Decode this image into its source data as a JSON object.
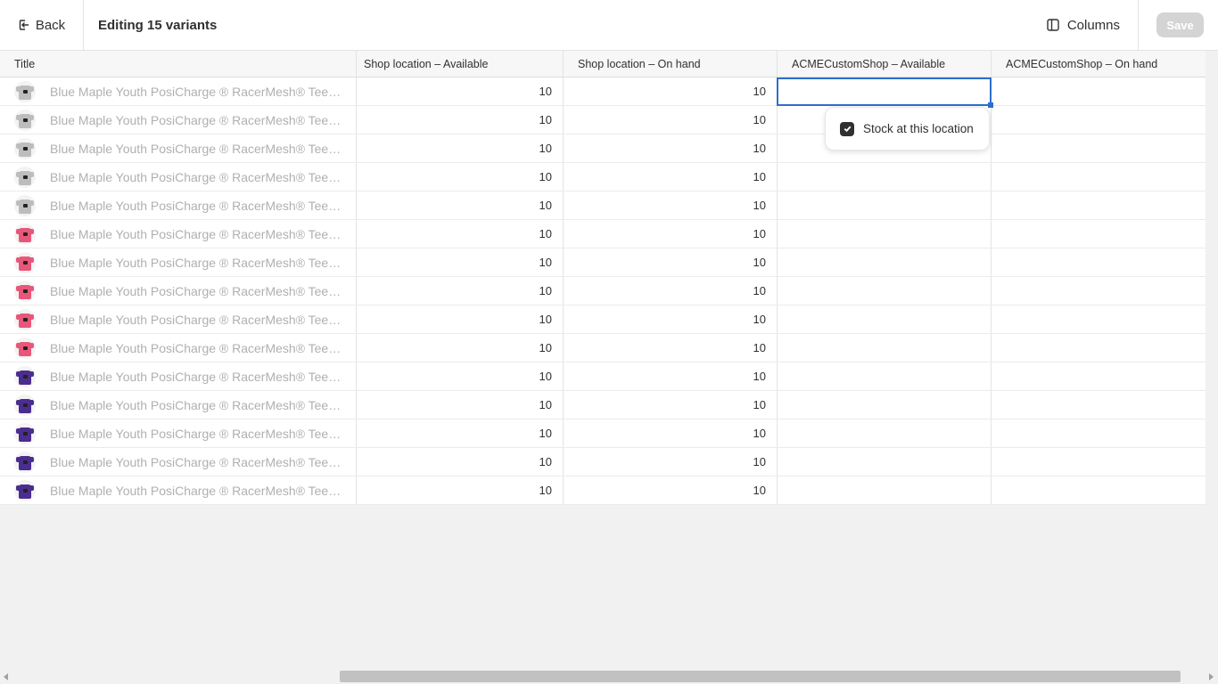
{
  "topbar": {
    "back_label": "Back",
    "title": "Editing 15 variants",
    "columns_label": "Columns",
    "save_label": "Save"
  },
  "table": {
    "headers": [
      "Title",
      "Shop location – Available",
      "Shop location – On hand",
      "ACMECustomShop – Available",
      "ACMECustomShop – On hand"
    ],
    "rows": [
      {
        "title": "Blue Maple Youth PosiCharge ® RacerMesh® Tee -...",
        "available": "10",
        "on_hand": "10",
        "color": "gray"
      },
      {
        "title": "Blue Maple Youth PosiCharge ® RacerMesh® Tee -...",
        "available": "10",
        "on_hand": "10",
        "color": "gray"
      },
      {
        "title": "Blue Maple Youth PosiCharge ® RacerMesh® Tee -...",
        "available": "10",
        "on_hand": "10",
        "color": "gray"
      },
      {
        "title": "Blue Maple Youth PosiCharge ® RacerMesh® Tee -...",
        "available": "10",
        "on_hand": "10",
        "color": "gray"
      },
      {
        "title": "Blue Maple Youth PosiCharge ® RacerMesh® Tee -...",
        "available": "10",
        "on_hand": "10",
        "color": "gray"
      },
      {
        "title": "Blue Maple Youth PosiCharge ® RacerMesh® Tee -...",
        "available": "10",
        "on_hand": "10",
        "color": "pink"
      },
      {
        "title": "Blue Maple Youth PosiCharge ® RacerMesh® Tee -...",
        "available": "10",
        "on_hand": "10",
        "color": "pink"
      },
      {
        "title": "Blue Maple Youth PosiCharge ® RacerMesh® Tee -...",
        "available": "10",
        "on_hand": "10",
        "color": "pink"
      },
      {
        "title": "Blue Maple Youth PosiCharge ® RacerMesh® Tee -...",
        "available": "10",
        "on_hand": "10",
        "color": "pink"
      },
      {
        "title": "Blue Maple Youth PosiCharge ® RacerMesh® Tee -...",
        "available": "10",
        "on_hand": "10",
        "color": "pink"
      },
      {
        "title": "Blue Maple Youth PosiCharge ® RacerMesh® Tee -...",
        "available": "10",
        "on_hand": "10",
        "color": "purple"
      },
      {
        "title": "Blue Maple Youth PosiCharge ® RacerMesh® Tee -...",
        "available": "10",
        "on_hand": "10",
        "color": "purple"
      },
      {
        "title": "Blue Maple Youth PosiCharge ® RacerMesh® Tee -...",
        "available": "10",
        "on_hand": "10",
        "color": "purple"
      },
      {
        "title": "Blue Maple Youth PosiCharge ® RacerMesh® Tee -...",
        "available": "10",
        "on_hand": "10",
        "color": "purple"
      },
      {
        "title": "Blue Maple Youth PosiCharge ® RacerMesh® Tee -...",
        "available": "10",
        "on_hand": "10",
        "color": "purple"
      }
    ]
  },
  "popover": {
    "checkbox_label": "Stock at this location",
    "checked": true
  },
  "colors": {
    "gray": "#bdbdbd",
    "pink": "#e8577a",
    "purple": "#4b2d8f",
    "selection": "#2c6ecb"
  },
  "icons": {
    "back": "exit-arrow-icon",
    "columns": "columns-icon",
    "check": "checkmark-icon"
  }
}
